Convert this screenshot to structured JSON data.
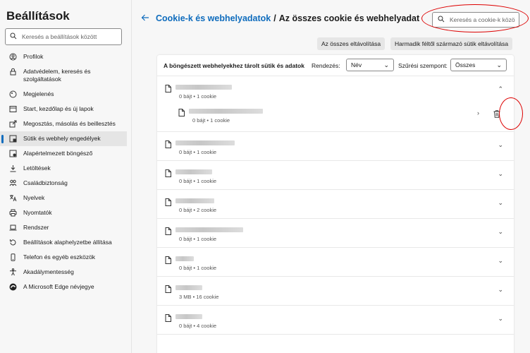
{
  "sidebar": {
    "title": "Beállítások",
    "search_placeholder": "Keresés a beállítások között",
    "items": [
      {
        "label": "Profilok",
        "icon": "profile-icon"
      },
      {
        "label": "Adatvédelem, keresés és szolgáltatások",
        "icon": "lock-icon"
      },
      {
        "label": "Megjelenés",
        "icon": "appearance-icon"
      },
      {
        "label": "Start, kezdőlap és új lapok",
        "icon": "home-tab-icon"
      },
      {
        "label": "Megosztás, másolás és beillesztés",
        "icon": "share-icon"
      },
      {
        "label": "Sütik és webhely engedélyek",
        "icon": "cookie-permissions-icon",
        "active": true
      },
      {
        "label": "Alapértelmezett böngésző",
        "icon": "browser-icon"
      },
      {
        "label": "Letöltések",
        "icon": "download-icon"
      },
      {
        "label": "Családbiztonság",
        "icon": "family-icon"
      },
      {
        "label": "Nyelvek",
        "icon": "language-icon"
      },
      {
        "label": "Nyomtatók",
        "icon": "printer-icon"
      },
      {
        "label": "Rendszer",
        "icon": "laptop-icon"
      },
      {
        "label": "Beállítások alaphelyzetbe állítása",
        "icon": "reset-icon"
      },
      {
        "label": "Telefon és egyéb eszközök",
        "icon": "phone-icon"
      },
      {
        "label": "Akadálymentesség",
        "icon": "accessibility-icon"
      },
      {
        "label": "A Microsoft Edge névjegye",
        "icon": "edge-logo-icon"
      }
    ]
  },
  "header": {
    "breadcrumb_link": "Cookie-k és webhelyadatok",
    "separator": "/",
    "current": "Az összes cookie és webhelyadat",
    "search_placeholder": "Keresés a cookie-k közö"
  },
  "actions": {
    "remove_all": "Az összes eltávolítása",
    "remove_third_party": "Harmadik féltől származó sütik eltávolítása"
  },
  "list": {
    "heading": "A böngészett webhelyekhez tárolt sütik és adatok",
    "sort_label": "Rendezés:",
    "sort_value": "Név",
    "filter_label": "Szűrési szempont:",
    "filter_value": "Összes",
    "rows": [
      {
        "meta": "0 bájt • 1 cookie",
        "expanded": true,
        "child_meta": "0 bájt • 1 cookie"
      },
      {
        "meta": "0 bájt • 1 cookie"
      },
      {
        "meta": "0 bájt • 1 cookie"
      },
      {
        "meta": "0 bájt • 2 cookie"
      },
      {
        "meta": "0 bájt • 1 cookie"
      },
      {
        "meta": "0 bájt • 1 cookie"
      },
      {
        "meta": "3 MB • 16 cookie"
      },
      {
        "meta": "0 bájt • 4 cookie"
      }
    ]
  },
  "colors": {
    "accent": "#0f6cbd",
    "highlight": "#dd0000"
  }
}
